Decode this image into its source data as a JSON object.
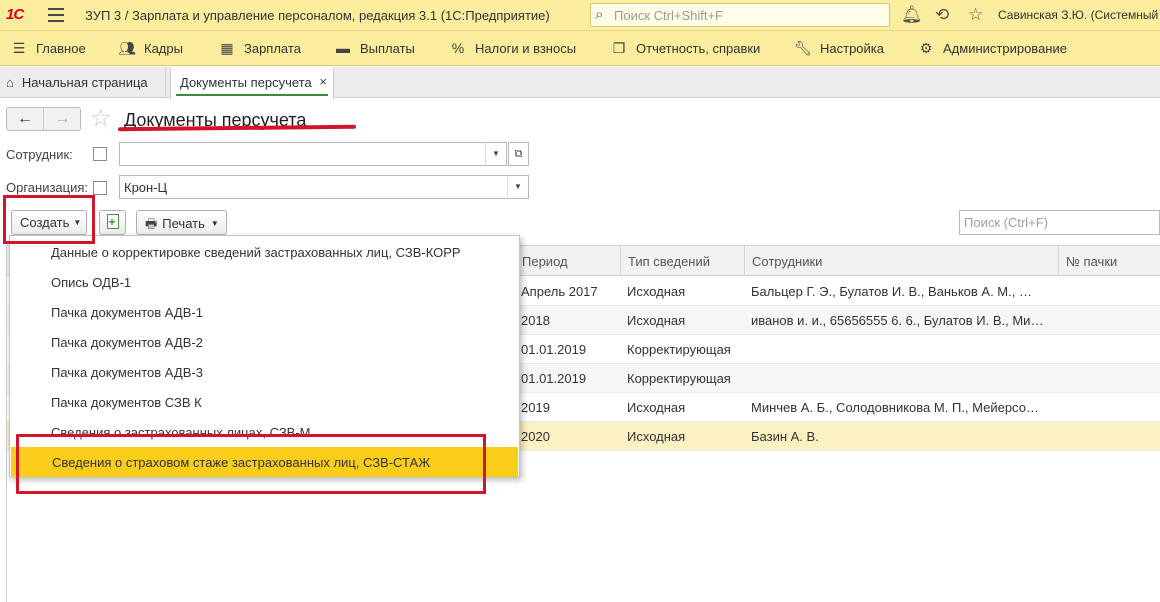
{
  "titlebar": {
    "logo": "1С",
    "app_title": "ЗУП 3 / Зарплата и управление персоналом, редакция 3.1 (1С:Предприятие)",
    "search_placeholder": "Поиск Ctrl+Shift+F",
    "user": "Савинская З.Ю. (Системный пр",
    "icons": [
      "bell-icon",
      "history-icon",
      "star-icon"
    ]
  },
  "sections": [
    {
      "label": "Главное",
      "icon": "menu-icon"
    },
    {
      "label": "Кадры",
      "icon": "people-icon"
    },
    {
      "label": "Зарплата",
      "icon": "calculator-icon"
    },
    {
      "label": "Выплаты",
      "icon": "wallet-icon"
    },
    {
      "label": "Налоги и взносы",
      "icon": "percent-icon"
    },
    {
      "label": "Отчетность, справки",
      "icon": "reports-icon"
    },
    {
      "label": "Настройка",
      "icon": "wrench-icon"
    },
    {
      "label": "Администрирование",
      "icon": "gear-icon"
    }
  ],
  "tabs": {
    "home": "Начальная страница",
    "active": "Документы персучета",
    "close": "×"
  },
  "page": {
    "title": "Документы персучета",
    "nav_back": "←",
    "nav_forward": "→",
    "favorite": "☆"
  },
  "filters": {
    "employee_label": "Сотрудник:",
    "employee_value": "",
    "org_label": "Организация:",
    "org_value": "Крон-Ц"
  },
  "toolbar": {
    "create": "Создать",
    "print": "Печать",
    "search_placeholder": "Поиск (Ctrl+F)"
  },
  "grid": {
    "columns": [
      "Период",
      "Тип сведений",
      "Сотрудники",
      "№ пачки"
    ],
    "rows": [
      {
        "period": "Апрель 2017",
        "type": "Исходная",
        "employees": "Бальцер Г. Э., Булатов И. В., Ваньков А. М., …",
        "pack": ""
      },
      {
        "period": "2018",
        "type": "Исходная",
        "employees": "иванов и. и., 65656555 6. 6., Булатов И. В., Ми…",
        "pack": ""
      },
      {
        "period": "01.01.2019",
        "type": "Корректирующая",
        "employees": "",
        "pack": ""
      },
      {
        "period": "01.01.2019",
        "type": "Корректирующая",
        "employees": "",
        "pack": ""
      },
      {
        "period": "2019",
        "type": "Исходная",
        "employees": "Минчев А. Б., Солодовникова М. П., Мейерсо…",
        "pack": ""
      },
      {
        "period": "2020",
        "type": "Исходная",
        "employees": "Базин А. В.",
        "pack": ""
      }
    ]
  },
  "create_menu": {
    "items": [
      "Данные о корректировке сведений застрахованных лиц, СЗВ-КОРР",
      "Опись ОДВ-1",
      "Пачка документов АДВ-1",
      "Пачка документов АДВ-2",
      "Пачка документов АДВ-3",
      "Пачка документов СЗВ К",
      "Сведения о застрахованных лицах, СЗВ-М",
      "Сведения о страховом стаже застрахованных лиц, СЗВ-СТАЖ"
    ],
    "highlighted_index": 7
  },
  "colors": {
    "header_bg": "#fbed9e",
    "highlight": "#f9cd1a",
    "selected_row": "#fcf1c2",
    "annotation_red": "#d4142a",
    "active_tab_underline": "#3b8b3b"
  }
}
